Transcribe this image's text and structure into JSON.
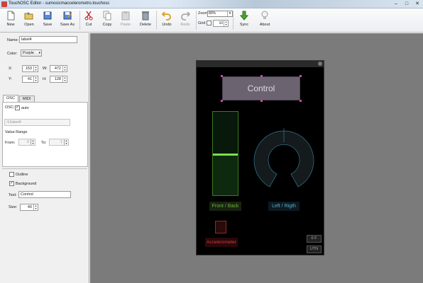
{
  "window": {
    "title": "TouchOSC Editor - sumosicmaccelerometro.touchosc",
    "controls": [
      "–",
      "□",
      "✕"
    ]
  },
  "toolbar": {
    "buttons": [
      {
        "label": "New",
        "icon": "new-file-icon"
      },
      {
        "label": "Open",
        "icon": "open-folder-icon"
      },
      {
        "label": "Save",
        "icon": "save-icon"
      },
      {
        "label": "Save As",
        "icon": "save-as-icon"
      },
      {
        "label": "Cut",
        "icon": "scissors-icon"
      },
      {
        "label": "Copy",
        "icon": "copy-icon"
      },
      {
        "label": "Paste",
        "icon": "paste-icon"
      },
      {
        "label": "Delete",
        "icon": "trash-icon"
      },
      {
        "label": "Undo",
        "icon": "undo-icon"
      },
      {
        "label": "Redo",
        "icon": "redo-icon"
      },
      {
        "label": "Sync",
        "icon": "sync-arrow-icon"
      },
      {
        "label": "About",
        "icon": "lightbulb-icon"
      }
    ],
    "zoom_label": "Zoom",
    "zoom_value": "80%",
    "grid_label": "Grid",
    "grid_size": "10"
  },
  "properties": {
    "name_label": "Name:",
    "name_value": "label4",
    "color_label": "Color:",
    "color_value": "Purple",
    "x_label": "X:",
    "x_value": "153",
    "y_label": "Y:",
    "y_value": "41",
    "w_label": "W:",
    "w_value": "472",
    "h_label": "H:",
    "h_value": "128",
    "tabs": [
      "OSC",
      "MIDI"
    ],
    "osc_label": "OSC:",
    "auto_label": "auto",
    "osc_address": "/1/label4",
    "value_range_label": "Value Range",
    "from_label": "From:",
    "from_value": "0",
    "to_label": "To:",
    "to_value": "1",
    "outline_label": "Outline",
    "background_label": "Background",
    "text_label": "Text:",
    "text_value": "Control",
    "size_label": "Size:",
    "size_value": "40"
  },
  "layout_preview": {
    "label_text": "Control",
    "fader_label": "Front / Back",
    "rotary_label": "Left / Rigth",
    "accel_label": "Accelerometer",
    "mini_button_1": "0 F",
    "mini_button_2": "UTN",
    "fader_level": 0.48,
    "colors": {
      "label": "#6b6470",
      "fader": "#7de04a",
      "rotary": "#2a6f80",
      "accel": "#d03a3a"
    }
  }
}
